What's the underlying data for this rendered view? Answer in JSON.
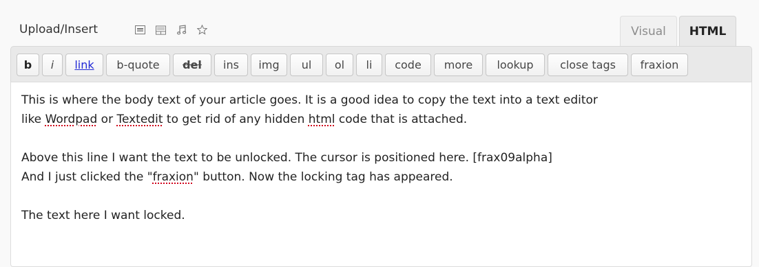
{
  "header": {
    "upload_label": "Upload/Insert",
    "media_icons": [
      "image-icon",
      "gallery-icon",
      "music-icon",
      "star-icon"
    ]
  },
  "tabs": {
    "visual": "Visual",
    "html": "HTML",
    "active": "HTML"
  },
  "toolbar": {
    "buttons": [
      "b",
      "i",
      "link",
      "b-quote",
      "del",
      "ins",
      "img",
      "ul",
      "ol",
      "li",
      "code",
      "more",
      "lookup",
      "close tags",
      "fraxion"
    ]
  },
  "editor": {
    "line1": "This is where the body text of your article goes. It is a good idea to copy the text into a text editor",
    "line2_a": "like ",
    "line2_wordpad": "Wordpad",
    "line2_b": " or ",
    "line2_textedit": "Textedit",
    "line2_c": " to get rid of any hidden ",
    "line2_html": "html",
    "line2_d": " code that is attached.",
    "line3": "Above this line I want the text to be unlocked. The cursor is positioned here. [frax09alpha]",
    "line4_a": "And I just clicked the \"",
    "line4_fraxion": "fraxion",
    "line4_b": "\" button. Now the locking tag has appeared.",
    "line5": "The text here I want locked."
  },
  "colors": {
    "link": "#2129d6",
    "spellcheck": "#d0021b",
    "toolbar_bg": "#e9e9e9"
  }
}
